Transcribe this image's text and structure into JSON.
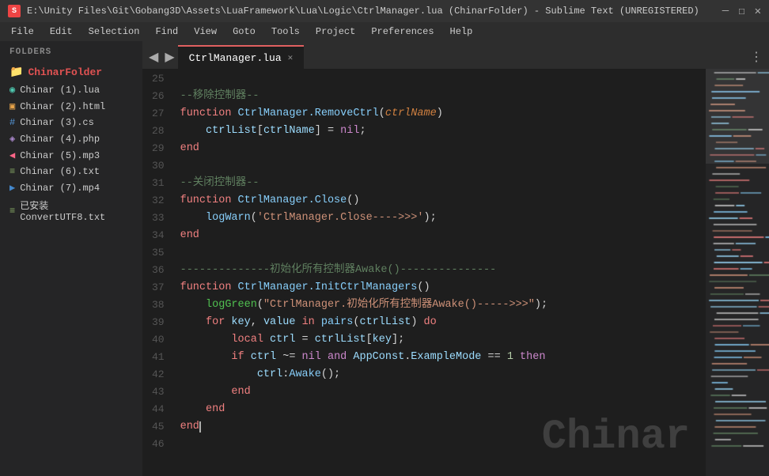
{
  "titleBar": {
    "icon": "ST",
    "text": "E:\\Unity Files\\Git\\Gobang3D\\Assets\\LuaFramework\\Lua\\Logic\\CtrlManager.lua (ChinarFolder) - Sublime Text (UNREGISTERED)",
    "minimize": "—",
    "maximize": "☐",
    "close": "✕"
  },
  "menuBar": {
    "items": [
      "File",
      "Edit",
      "Selection",
      "Find",
      "View",
      "Goto",
      "Tools",
      "Project",
      "Preferences",
      "Help"
    ]
  },
  "sidebar": {
    "header": "FOLDERS",
    "folder": "ChinarFolder",
    "files": [
      {
        "name": "Chinar (1).lua",
        "color": "#4ec9b0",
        "icon": "◉"
      },
      {
        "name": "Chinar (2).html",
        "color": "#e8a44a",
        "icon": "▣"
      },
      {
        "name": "Chinar (3).cs",
        "color": "#5599dd",
        "icon": "#"
      },
      {
        "name": "Chinar (4).php",
        "color": "#aa88cc",
        "icon": "◈"
      },
      {
        "name": "Chinar (5).mp3",
        "color": "#ff6688",
        "icon": "◀"
      },
      {
        "name": "Chinar (6).txt",
        "color": "#88aa66",
        "icon": "≡"
      },
      {
        "name": "Chinar (7).mp4",
        "color": "#4488cc",
        "icon": "▶"
      },
      {
        "name": "已安装ConvertUTF8.txt",
        "color": "#88aa66",
        "icon": "≡"
      }
    ]
  },
  "tabs": {
    "prev": "◀",
    "next": "▶",
    "active": "CtrlManager.lua",
    "close": "✕",
    "more": "⋮"
  },
  "editor": {
    "startLine": 25,
    "lines": [
      {
        "num": 25,
        "content": ""
      },
      {
        "num": 26,
        "content": "--移除控制器--",
        "type": "comment"
      },
      {
        "num": 27,
        "content": "function CtrlManager.RemoveCtrl(ctrlName)",
        "type": "code"
      },
      {
        "num": 28,
        "content": "    ctrlList[ctrlName] = nil;",
        "type": "code"
      },
      {
        "num": 29,
        "content": "end",
        "type": "code"
      },
      {
        "num": 30,
        "content": ""
      },
      {
        "num": 31,
        "content": "--关闭控制器--",
        "type": "comment"
      },
      {
        "num": 32,
        "content": "function CtrlManager.Close()",
        "type": "code"
      },
      {
        "num": 33,
        "content": "    logWarn('CtrlManager.Close---->>>');",
        "type": "code"
      },
      {
        "num": 34,
        "content": "end",
        "type": "code"
      },
      {
        "num": 35,
        "content": ""
      },
      {
        "num": 36,
        "content": "--------------初始化所有控制器Awake()---------------",
        "type": "comment"
      },
      {
        "num": 37,
        "content": "function CtrlManager.InitCtrlManagers()",
        "type": "code"
      },
      {
        "num": 38,
        "content": "    logGreen(\"CtrlManager.初始化所有控制器Awake()----->>>\");",
        "type": "code"
      },
      {
        "num": 39,
        "content": "    for key, value in pairs(ctrlList) do",
        "type": "code"
      },
      {
        "num": 40,
        "content": "        local ctrl = ctrlList[key];",
        "type": "code"
      },
      {
        "num": 41,
        "content": "        if ctrl ~= nil and AppConst.ExampleMode == 1 then",
        "type": "code"
      },
      {
        "num": 42,
        "content": "            ctrl:Awake();",
        "type": "code"
      },
      {
        "num": 43,
        "content": "        end",
        "type": "code"
      },
      {
        "num": 44,
        "content": "    end",
        "type": "code"
      },
      {
        "num": 45,
        "content": "end",
        "type": "code"
      },
      {
        "num": 46,
        "content": ""
      }
    ]
  },
  "watermark": "Chinar"
}
